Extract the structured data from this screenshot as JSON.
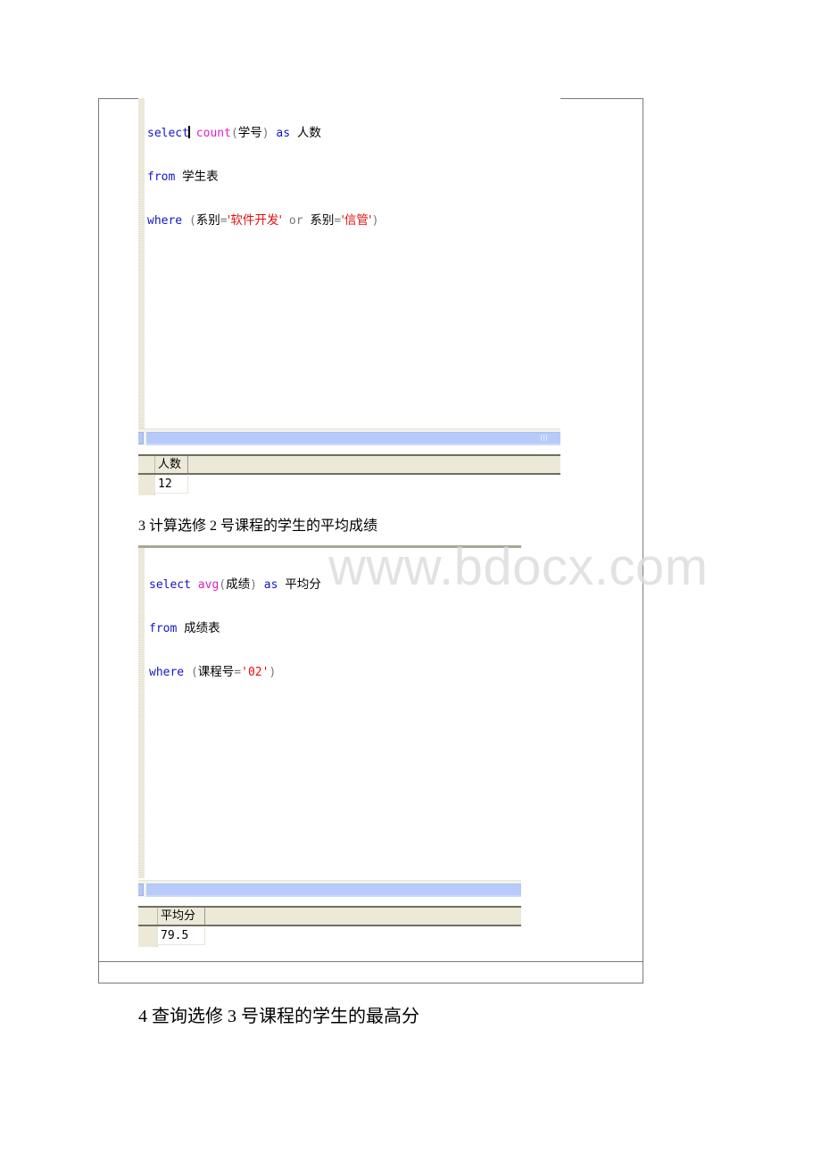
{
  "screenshot1": {
    "code_lines": {
      "line1": {
        "kw1": "select",
        "fn": "count",
        "paren_open": "(",
        "arg": "学号",
        "paren_close": ")",
        "kw2": "as",
        "alias": "人数"
      },
      "line2": {
        "kw": "from",
        "table": "学生表"
      },
      "line3": {
        "kw": "where",
        "open": "(",
        "col1": "系别",
        "eq1": "=",
        "str1": "'软件开发'",
        "op": "or",
        "col2": "系别",
        "eq2": "=",
        "str2": "'信管'",
        "close": ")"
      }
    },
    "result": {
      "columns": [
        "人数"
      ],
      "rows": [
        [
          "12"
        ]
      ]
    }
  },
  "caption": "3 计算选修 2 号课程的学生的平均成绩",
  "screenshot2": {
    "code_lines": {
      "line1": {
        "kw1": "select",
        "fn": "avg",
        "paren_open": "(",
        "arg": "成绩",
        "paren_close": ")",
        "kw2": "as",
        "alias": "平均分"
      },
      "line2": {
        "kw": "from",
        "table": "成绩表"
      },
      "line3": {
        "kw": "where",
        "open": "(",
        "col": "课程号",
        "eq": "=",
        "str": "'02'",
        "close": ")"
      }
    },
    "result": {
      "columns": [
        "平均分"
      ],
      "rows": [
        [
          "79.5"
        ]
      ]
    }
  },
  "watermark": "www.bdocx.com",
  "heading": "4 查询选修 3 号课程的学生的最高分",
  "colors": {
    "keyword": "#1515c8",
    "function": "#e020c8",
    "string": "#e01010",
    "scrollbar": "#b7cbfb",
    "grid_header": "#ece9d8"
  }
}
